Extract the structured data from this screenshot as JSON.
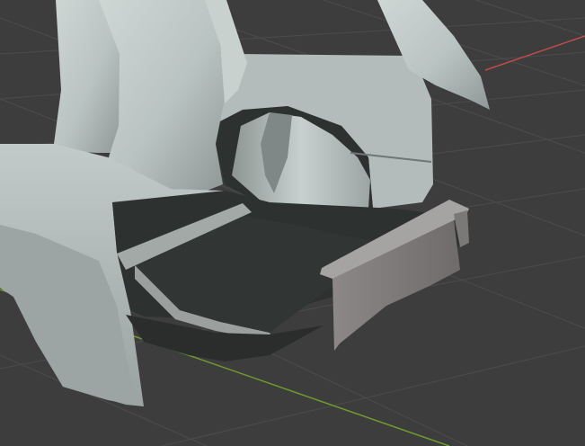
{
  "viewport": {
    "name": "3D Viewport",
    "shading": "solid",
    "background": "#3d3d3d",
    "grid_color": "#4c4c4c",
    "x_axis_color": "#c24a4a",
    "y_axis_color": "#6f9a2d"
  },
  "scene": {
    "object": "car-body-rear-section",
    "mesh_color": "#b9c3c1",
    "interior_color": "#2d3130",
    "bumper_color": "#8a8686"
  }
}
